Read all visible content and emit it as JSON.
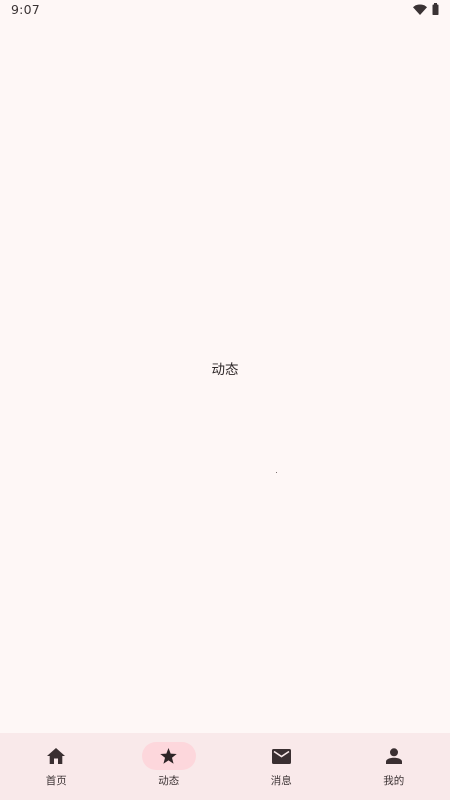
{
  "status_bar": {
    "time": "9:07",
    "icons": [
      "wifi-icon",
      "battery-icon"
    ]
  },
  "main": {
    "label": "动态"
  },
  "bottom_nav": {
    "items": [
      {
        "label": "首页",
        "icon": "home-icon",
        "selected": false
      },
      {
        "label": "动态",
        "icon": "star-icon",
        "selected": true
      },
      {
        "label": "消息",
        "icon": "mail-icon",
        "selected": false
      },
      {
        "label": "我的",
        "icon": "person-icon",
        "selected": false
      }
    ],
    "colors": {
      "background": "#f9e9ea",
      "active_indicator": "#fdd7dc",
      "icon": "#3a2f31"
    }
  },
  "colors": {
    "page_background": "#fef7f6",
    "text": "#2f2829"
  }
}
